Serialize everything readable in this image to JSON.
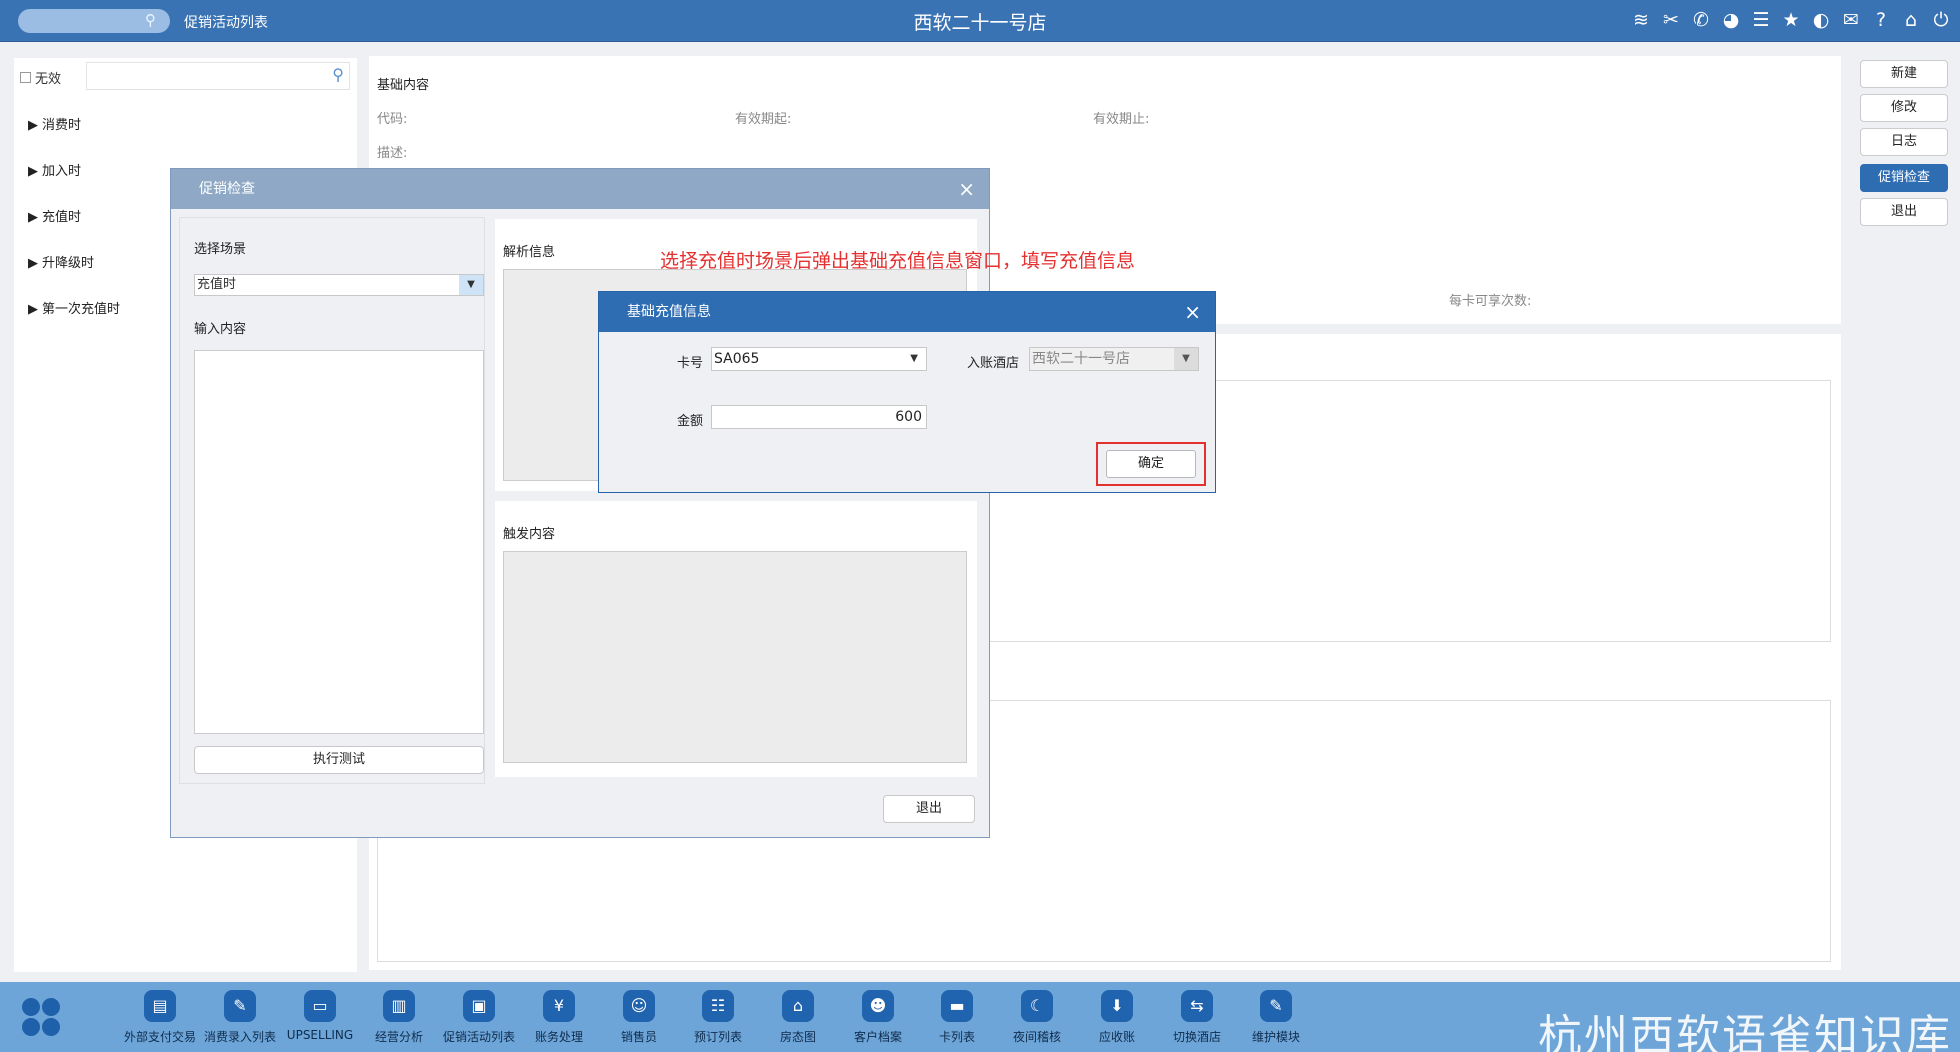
{
  "topbar": {
    "page_name": "促销活动列表",
    "hotel_name": "西软二十一号店"
  },
  "leftpanel": {
    "invalid_label": "无效",
    "tree": [
      "消费时",
      "加入时",
      "充值时",
      "升降级时",
      "第一次充值时"
    ]
  },
  "main": {
    "section_title": "基础内容",
    "code_label": "代码:",
    "valid_from_label": "有效期起:",
    "valid_to_label": "有效期止:",
    "desc_label": "描述:",
    "per_card_label": "每卡可享次数:"
  },
  "right_buttons": [
    "新建",
    "修改",
    "日志",
    "促销检查",
    "退出"
  ],
  "dialog1": {
    "title": "促销检查",
    "scene_label": "选择场景",
    "scene_value": "充值时",
    "input_label": "输入内容",
    "run_test": "执行测试",
    "parse_label": "解析信息",
    "trigger_label": "触发内容",
    "exit": "退出"
  },
  "annotation": "选择充值时场景后弹出基础充值信息窗口，填写充值信息",
  "dialog2": {
    "title": "基础充值信息",
    "card_label": "卡号",
    "card_value": "SA065",
    "hotel_label": "入账酒店",
    "hotel_value": "西软二十一号店",
    "amount_label": "金额",
    "amount_value": "600",
    "confirm": "确定"
  },
  "bottom_items": [
    "外部支付交易",
    "消费录入列表",
    "UPSELLING",
    "经营分析",
    "促销活动列表",
    "账务处理",
    "销售员",
    "预订列表",
    "房态图",
    "客户档案",
    "卡列表",
    "夜间稽核",
    "应收账",
    "切换酒店",
    "维护模块"
  ],
  "watermark": "杭州西软语雀知识库"
}
